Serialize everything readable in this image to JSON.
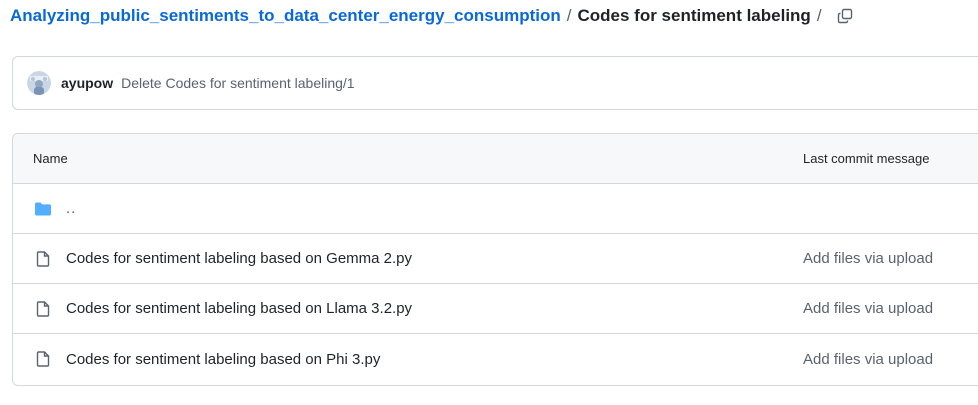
{
  "breadcrumb": {
    "repo": "Analyzing_public_sentiments_to_data_center_energy_consumption",
    "separator": "/",
    "current": "Codes for sentiment labeling",
    "trailing_separator": "/",
    "copy_icon": "copy-icon"
  },
  "latest_commit": {
    "author": "ayupow",
    "message": "Delete Codes for sentiment labeling/1",
    "avatar_icon": "avatar"
  },
  "file_table": {
    "headers": {
      "name": "Name",
      "last_commit_message": "Last commit message"
    },
    "parent": {
      "label": "..",
      "icon": "folder-icon",
      "icon_color": "#54aeff"
    },
    "rows": [
      {
        "name": "Codes for sentiment labeling based on Gemma 2.py",
        "message": "Add files via upload",
        "icon": "file-icon"
      },
      {
        "name": "Codes for sentiment labeling based on Llama 3.2.py",
        "message": "Add files via upload",
        "icon": "file-icon"
      },
      {
        "name": "Codes for sentiment labeling based on Phi 3.py",
        "message": "Add files via upload",
        "icon": "file-icon"
      }
    ]
  },
  "colors": {
    "link": "#0969da",
    "text": "#1f2328",
    "muted": "#59636e",
    "border": "#d1d9e0",
    "header_bg": "#f6f8fa"
  }
}
